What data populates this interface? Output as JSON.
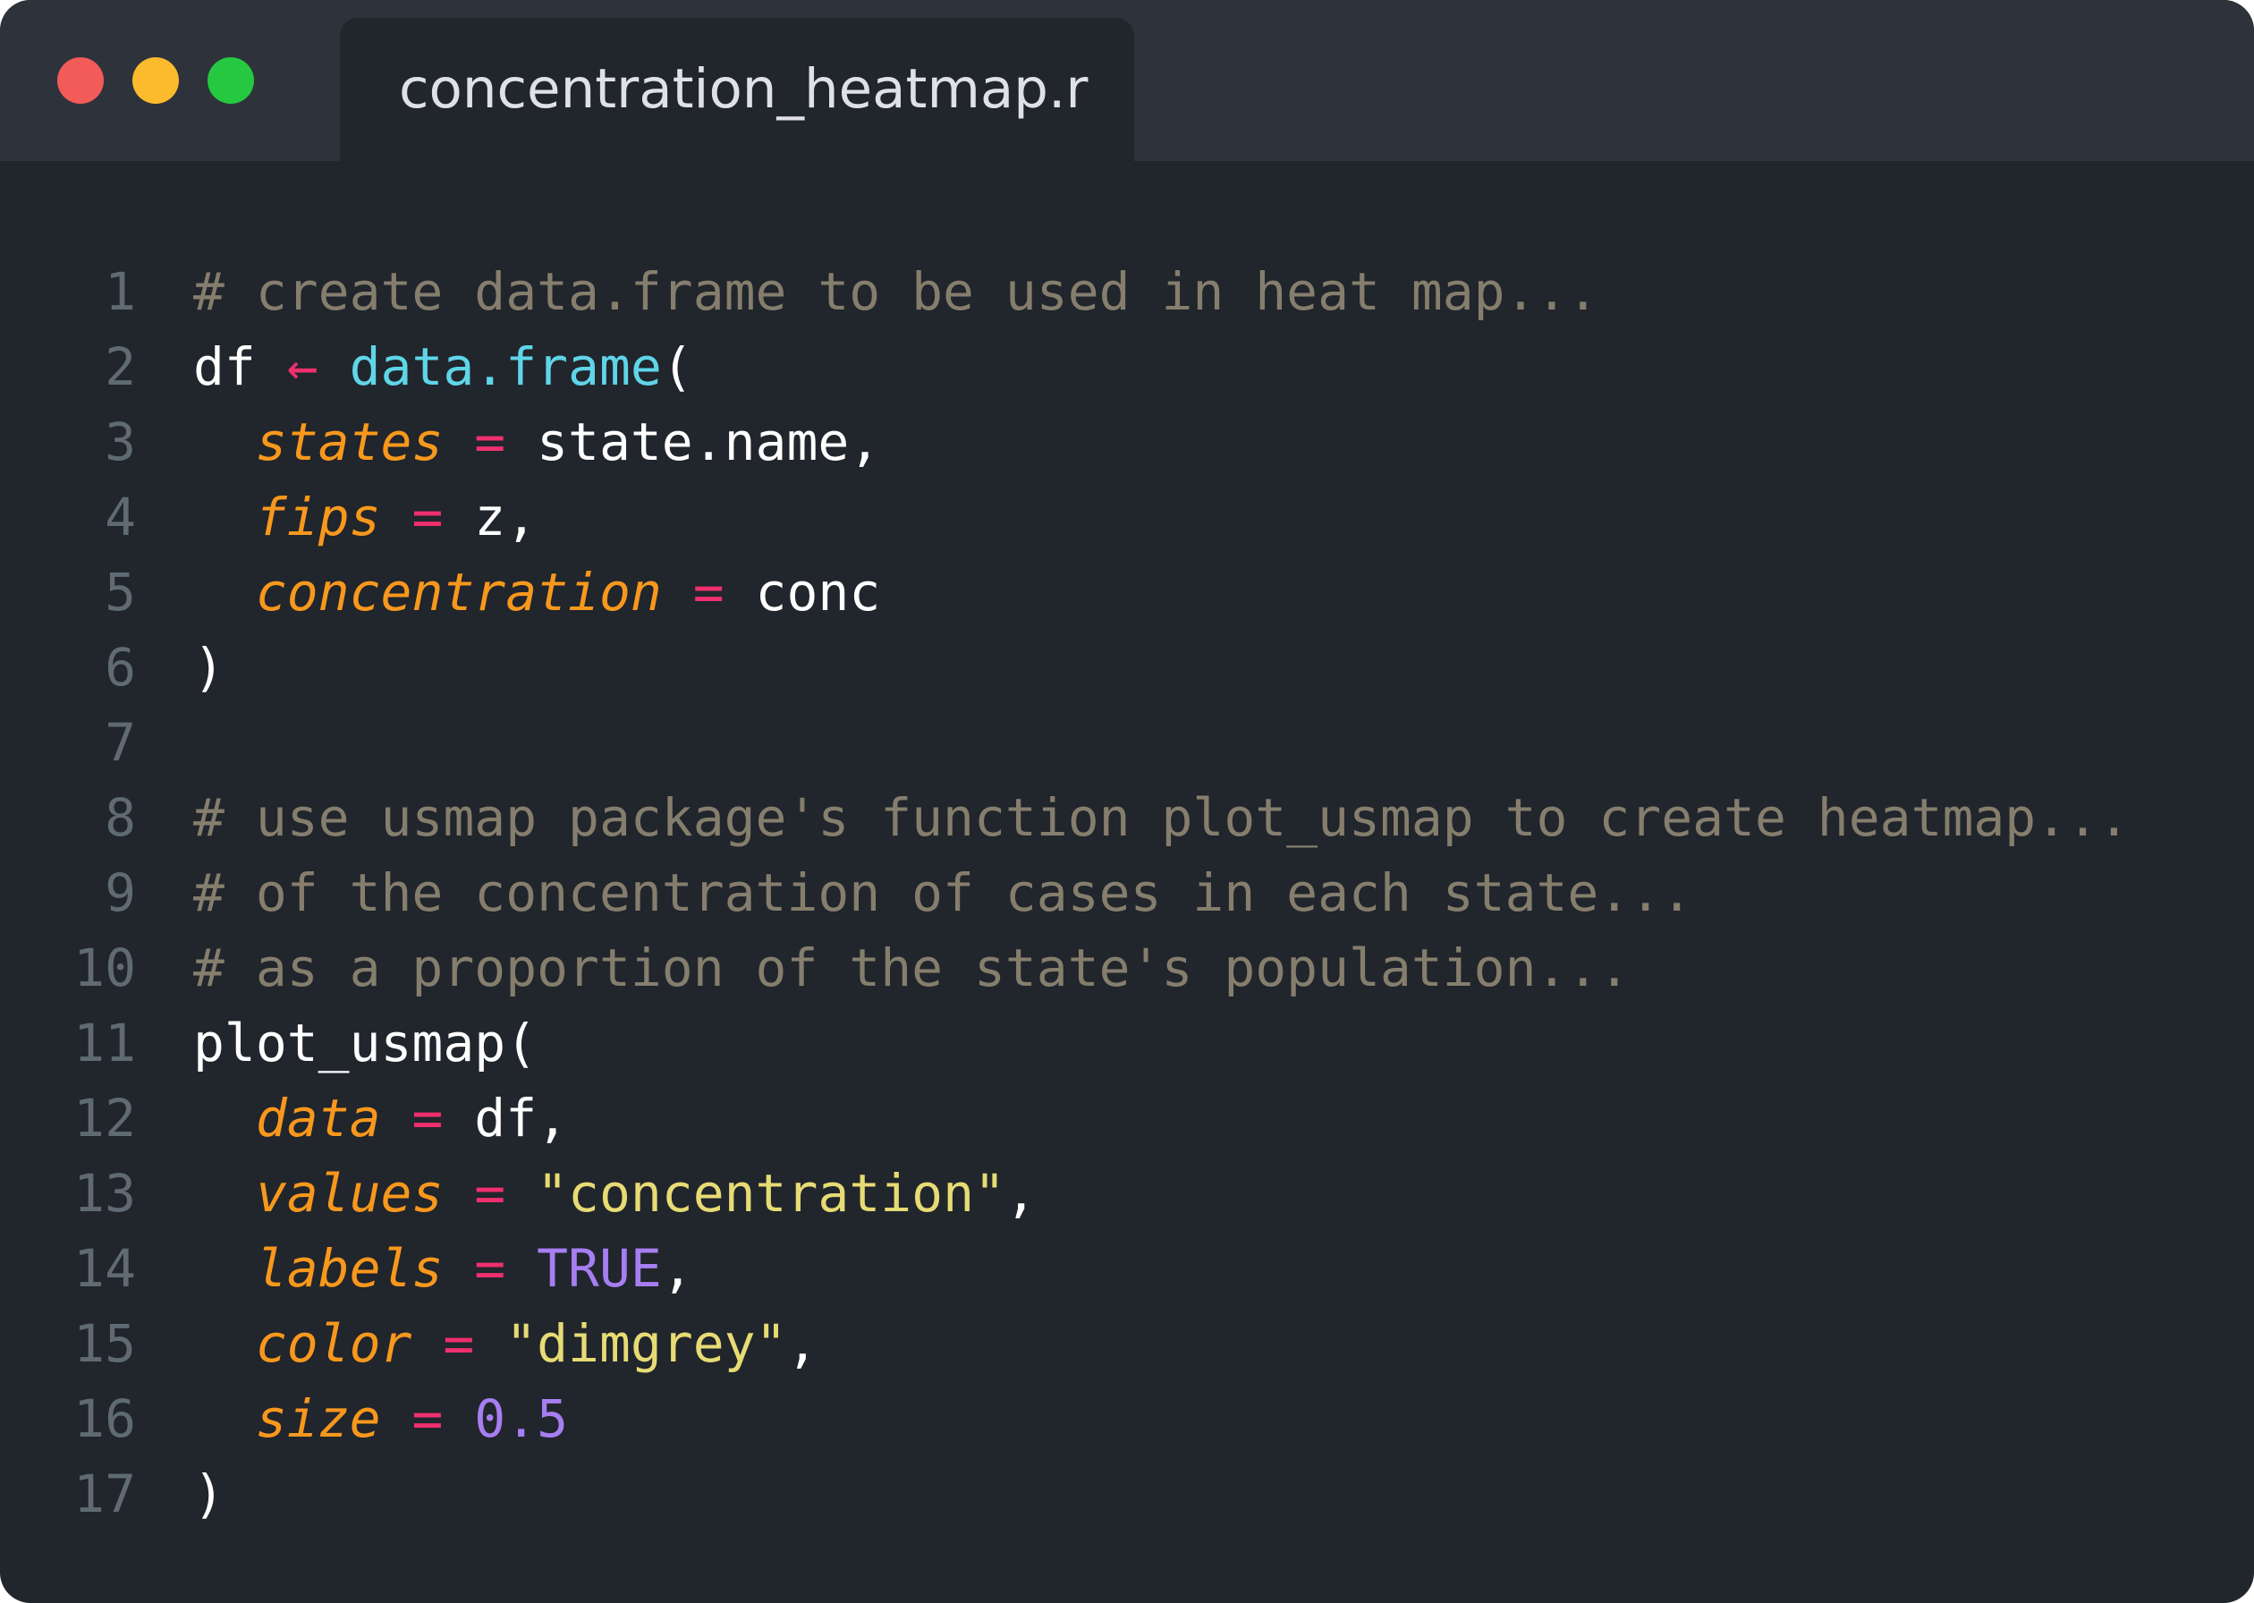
{
  "window": {
    "controls": {
      "close_color": "#f25b57",
      "minimize_color": "#fcbb2c",
      "maximize_color": "#26c841"
    },
    "tab": {
      "title": "concentration_heatmap.r"
    }
  },
  "editor": {
    "language": "r",
    "token_colors": {
      "comment": "#857e6d",
      "plain": "#ffffff",
      "operator": "#f0306e",
      "function": "#5fd5e8",
      "argument": "#f7981d",
      "string": "#e7db74",
      "constant": "#a77ef2",
      "line_number": "#5f6a72"
    },
    "lines": [
      {
        "number": "1",
        "tokens": [
          {
            "type": "comment",
            "text": "# create data.frame to be used in heat map..."
          }
        ]
      },
      {
        "number": "2",
        "tokens": [
          {
            "type": "plain",
            "text": "df "
          },
          {
            "type": "op",
            "text": "←"
          },
          {
            "type": "plain",
            "text": " "
          },
          {
            "type": "fn",
            "text": "data.frame"
          },
          {
            "type": "plain",
            "text": "("
          }
        ]
      },
      {
        "number": "3",
        "tokens": [
          {
            "type": "plain",
            "text": "  "
          },
          {
            "type": "arg",
            "text": "states"
          },
          {
            "type": "plain",
            "text": " "
          },
          {
            "type": "op",
            "text": "="
          },
          {
            "type": "plain",
            "text": " state.name,"
          }
        ]
      },
      {
        "number": "4",
        "tokens": [
          {
            "type": "plain",
            "text": "  "
          },
          {
            "type": "arg",
            "text": "fips"
          },
          {
            "type": "plain",
            "text": " "
          },
          {
            "type": "op",
            "text": "="
          },
          {
            "type": "plain",
            "text": " z,"
          }
        ]
      },
      {
        "number": "5",
        "tokens": [
          {
            "type": "plain",
            "text": "  "
          },
          {
            "type": "arg",
            "text": "concentration"
          },
          {
            "type": "plain",
            "text": " "
          },
          {
            "type": "op",
            "text": "="
          },
          {
            "type": "plain",
            "text": " conc"
          }
        ]
      },
      {
        "number": "6",
        "tokens": [
          {
            "type": "plain",
            "text": ")"
          }
        ]
      },
      {
        "number": "7",
        "tokens": []
      },
      {
        "number": "8",
        "tokens": [
          {
            "type": "comment",
            "text": "# use usmap package's function plot_usmap to create heatmap..."
          }
        ]
      },
      {
        "number": "9",
        "tokens": [
          {
            "type": "comment",
            "text": "# of the concentration of cases in each state..."
          }
        ]
      },
      {
        "number": "10",
        "tokens": [
          {
            "type": "comment",
            "text": "# as a proportion of the state's population..."
          }
        ]
      },
      {
        "number": "11",
        "tokens": [
          {
            "type": "plain",
            "text": "plot_usmap("
          }
        ]
      },
      {
        "number": "12",
        "tokens": [
          {
            "type": "plain",
            "text": "  "
          },
          {
            "type": "arg",
            "text": "data"
          },
          {
            "type": "plain",
            "text": " "
          },
          {
            "type": "op",
            "text": "="
          },
          {
            "type": "plain",
            "text": " df,"
          }
        ]
      },
      {
        "number": "13",
        "tokens": [
          {
            "type": "plain",
            "text": "  "
          },
          {
            "type": "arg",
            "text": "values"
          },
          {
            "type": "plain",
            "text": " "
          },
          {
            "type": "op",
            "text": "="
          },
          {
            "type": "plain",
            "text": " "
          },
          {
            "type": "str",
            "text": "\"concentration\""
          },
          {
            "type": "plain",
            "text": ","
          }
        ]
      },
      {
        "number": "14",
        "tokens": [
          {
            "type": "plain",
            "text": "  "
          },
          {
            "type": "arg",
            "text": "labels"
          },
          {
            "type": "plain",
            "text": " "
          },
          {
            "type": "op",
            "text": "="
          },
          {
            "type": "plain",
            "text": " "
          },
          {
            "type": "const",
            "text": "TRUE"
          },
          {
            "type": "plain",
            "text": ","
          }
        ]
      },
      {
        "number": "15",
        "tokens": [
          {
            "type": "plain",
            "text": "  "
          },
          {
            "type": "arg",
            "text": "color"
          },
          {
            "type": "plain",
            "text": " "
          },
          {
            "type": "op",
            "text": "="
          },
          {
            "type": "plain",
            "text": " "
          },
          {
            "type": "str",
            "text": "\"dimgrey\""
          },
          {
            "type": "plain",
            "text": ","
          }
        ]
      },
      {
        "number": "16",
        "tokens": [
          {
            "type": "plain",
            "text": "  "
          },
          {
            "type": "arg",
            "text": "size"
          },
          {
            "type": "plain",
            "text": " "
          },
          {
            "type": "op",
            "text": "="
          },
          {
            "type": "plain",
            "text": " "
          },
          {
            "type": "const",
            "text": "0.5"
          }
        ]
      },
      {
        "number": "17",
        "tokens": [
          {
            "type": "plain",
            "text": ")"
          }
        ]
      }
    ]
  }
}
